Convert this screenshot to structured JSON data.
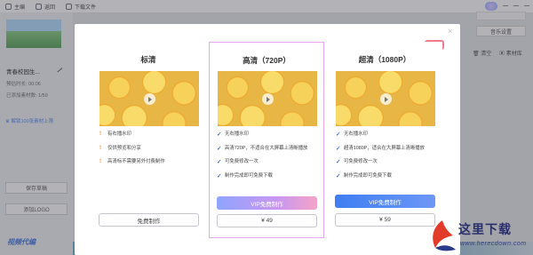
{
  "titlebar": {
    "items": [
      {
        "label": "主编"
      },
      {
        "label": "返回"
      },
      {
        "label": "下载文件"
      }
    ]
  },
  "sidebar": {
    "project_name": "青春校园生...",
    "lines": [
      "预估时长: 00:06",
      "已添加素材数: 1/50"
    ],
    "unlock_link": "解锁100张素材上限",
    "save_button": "保存草稿",
    "add_logo_button": "添加LOGO",
    "logo_text": "视频代编"
  },
  "right_panel": {
    "music_settings": "音乐设置",
    "clear": "清空",
    "material_library": "素材库"
  },
  "modal": {
    "close_glyph": "×",
    "badge_glyph": "👍",
    "plans": [
      {
        "id": "std",
        "title": "标清",
        "features": [
          {
            "mark": "!",
            "text": "有右播水印"
          },
          {
            "mark": "!",
            "text": "仅供预览和分享"
          },
          {
            "mark": "!",
            "text": "高清标不需要另外付费制作"
          }
        ],
        "vip_label": "",
        "price_label": "免费制作"
      },
      {
        "id": "hd",
        "title": "高清（720P）",
        "features": [
          {
            "mark": "✓",
            "text": "无右播水印"
          },
          {
            "mark": "✓",
            "text": "高清720P，不适合在大屏幕上清晰播放"
          },
          {
            "mark": "✓",
            "text": "可免费修改一次"
          },
          {
            "mark": "✓",
            "text": "制作完成即可免费下载"
          }
        ],
        "vip_label": "VIP免费制作",
        "price_label": "¥ 49"
      },
      {
        "id": "uhd",
        "title": "超清（1080P）",
        "features": [
          {
            "mark": "✓",
            "text": "无右播水印"
          },
          {
            "mark": "✓",
            "text": "超清1080P，适合在大屏幕上清晰播放"
          },
          {
            "mark": "✓",
            "text": "可免费修改一次"
          },
          {
            "mark": "✓",
            "text": "制作完成即可免费下载"
          }
        ],
        "vip_label": "VIP免费制作",
        "price_label": "¥ 59"
      }
    ]
  },
  "watermark": {
    "title": "这里下载",
    "subtitle": "www.herecdown.com"
  }
}
